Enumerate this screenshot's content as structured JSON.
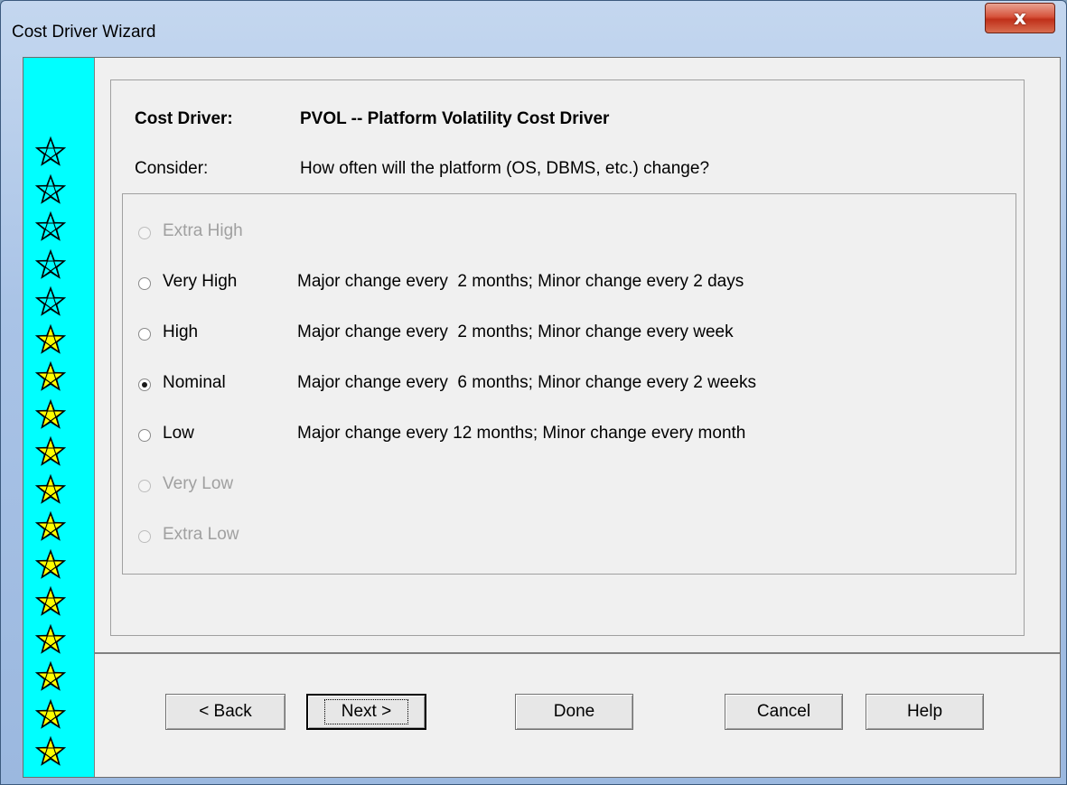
{
  "window": {
    "title": "Cost Driver Wizard",
    "close_glyph": "x"
  },
  "stars": {
    "outline_count": 5,
    "filled_count": 12,
    "outline_color": "#00ffff",
    "filled_color": "#ffff00"
  },
  "header": {
    "cost_driver_label": "Cost Driver:",
    "cost_driver_value": "PVOL -- Platform Volatility Cost Driver",
    "consider_label": "Consider:",
    "consider_value": "How often will the platform (OS, DBMS, etc.) change?"
  },
  "ratings": [
    {
      "label": "Extra High",
      "description": "",
      "enabled": false,
      "selected": false
    },
    {
      "label": "Very High",
      "description": "Major change every  2 months; Minor change every 2 days",
      "enabled": true,
      "selected": false
    },
    {
      "label": "High",
      "description": "Major change every  2 months; Minor change every week",
      "enabled": true,
      "selected": false
    },
    {
      "label": "Nominal",
      "description": "Major change every  6 months; Minor change every 2 weeks",
      "enabled": true,
      "selected": true
    },
    {
      "label": "Low",
      "description": "Major change every 12 months; Minor change every month",
      "enabled": true,
      "selected": false
    },
    {
      "label": "Very Low",
      "description": "",
      "enabled": false,
      "selected": false
    },
    {
      "label": "Extra Low",
      "description": "",
      "enabled": false,
      "selected": false
    }
  ],
  "buttons": {
    "back": "< Back",
    "next": "Next >",
    "done": "Done",
    "cancel": "Cancel",
    "help": "Help"
  }
}
